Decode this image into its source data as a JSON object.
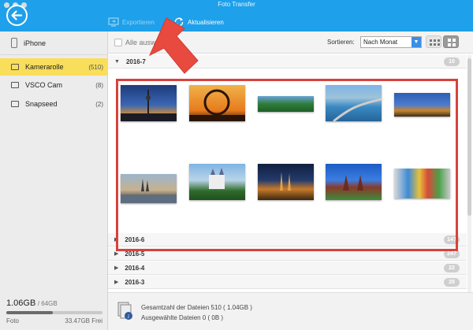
{
  "window": {
    "title": "Foto Transfer"
  },
  "toolbar": {
    "export_label": "Exportieren",
    "refresh_label": "Aktualisieren"
  },
  "sidebar": {
    "device": "iPhone",
    "items": [
      {
        "label": "Kamerarolle",
        "count": "(510)",
        "active": true
      },
      {
        "label": "VSCO Cam",
        "count": "(8)",
        "active": false
      },
      {
        "label": "Snapseed",
        "count": "(2)",
        "active": false
      }
    ],
    "storage": {
      "used": "1.06GB",
      "total": "/ 64GB",
      "free": "33.47GB Frei",
      "label": "Foto",
      "used_fraction": 0.48
    }
  },
  "controls": {
    "select_all": "Alle auswä",
    "sort_label": "Sortieren:",
    "sort_value": "Nach Monat"
  },
  "groups": [
    {
      "label": "2016-7",
      "count": "10",
      "expanded": true
    },
    {
      "label": "2016-6",
      "count": "147",
      "expanded": false
    },
    {
      "label": "2016-5",
      "count": "247",
      "expanded": false
    },
    {
      "label": "2016-4",
      "count": "22",
      "expanded": false
    },
    {
      "label": "2016-3",
      "count": "28",
      "expanded": false
    }
  ],
  "photos": [
    "berlin-tv-tower-dusk",
    "roller-coaster-sunset",
    "green-landscape",
    "coastal-road",
    "city-skyline-night",
    "cologne-cathedral-river",
    "neuschwanstein-castle",
    "cathedral-night",
    "holstentor-gate",
    "graffiti-wall"
  ],
  "footer": {
    "total": "Gesamtzahl der Dateien 510 ( 1.04GB )",
    "selected": "Ausgewählte Dateien 0 ( 0B )"
  },
  "colors": {
    "accent": "#1ea0ea",
    "active_item": "#f9de5b",
    "highlight_border": "#d9413c",
    "arrow": "#e84a3f"
  }
}
